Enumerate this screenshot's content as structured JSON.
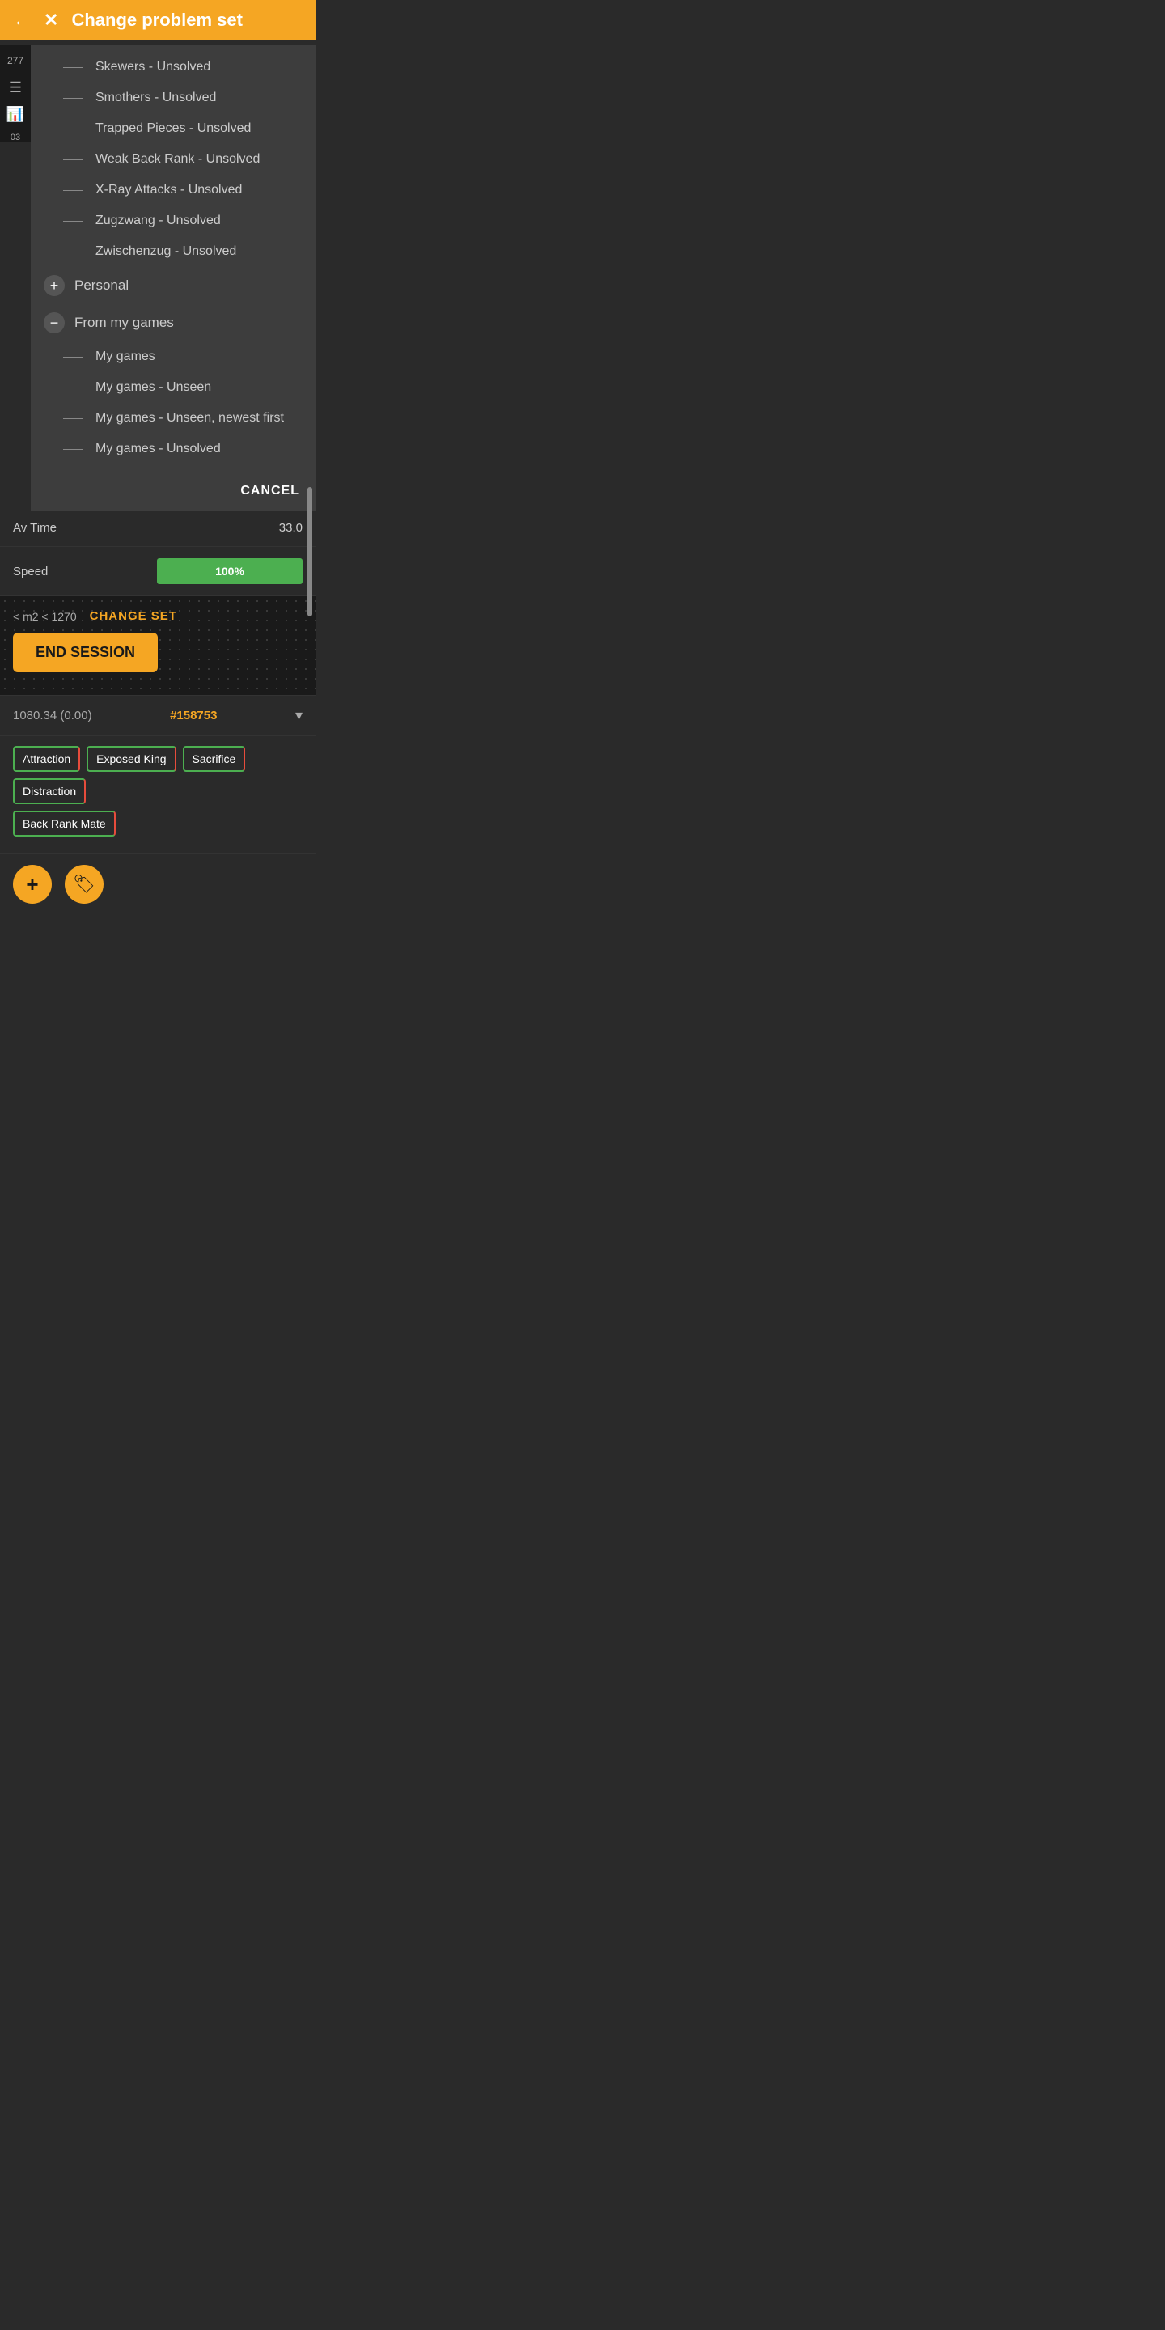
{
  "header": {
    "title": "Change problem set",
    "back_label": "←",
    "close_label": "✕"
  },
  "sidebar": {
    "rating": "277",
    "rating2": "03"
  },
  "overlay": {
    "items_unsolved": [
      "Skewers - Unsolved",
      "Smothers - Unsolved",
      "Trapped Pieces - Unsolved",
      "Weak Back Rank - Unsolved",
      "X-Ray Attacks - Unsolved",
      "Zugzwang - Unsolved",
      "Zwischenzug - Unsolved"
    ],
    "personal_label": "Personal",
    "from_my_games_label": "From my games",
    "my_games_items": [
      "My games",
      "My games - Unseen",
      "My games - Unseen, newest first",
      "My games - Unsolved"
    ],
    "cancel_label": "CANCEL"
  },
  "stats": {
    "av_time_label": "Av Time",
    "av_time_value": "33.0",
    "speed_label": "Speed",
    "speed_value": "100%"
  },
  "session": {
    "elo_range": "< m2 < 1270",
    "change_set_label": "CHANGE SET",
    "end_session_label": "END SESSION"
  },
  "game_info": {
    "score": "1080.34 (0.00)",
    "game_id": "#158753",
    "chevron": "▾"
  },
  "tags": [
    "Attraction",
    "Exposed King",
    "Sacrifice",
    "Distraction",
    "Back Rank Mate"
  ],
  "bottom_actions": {
    "add_label": "+",
    "tag_icon": "🏷"
  }
}
